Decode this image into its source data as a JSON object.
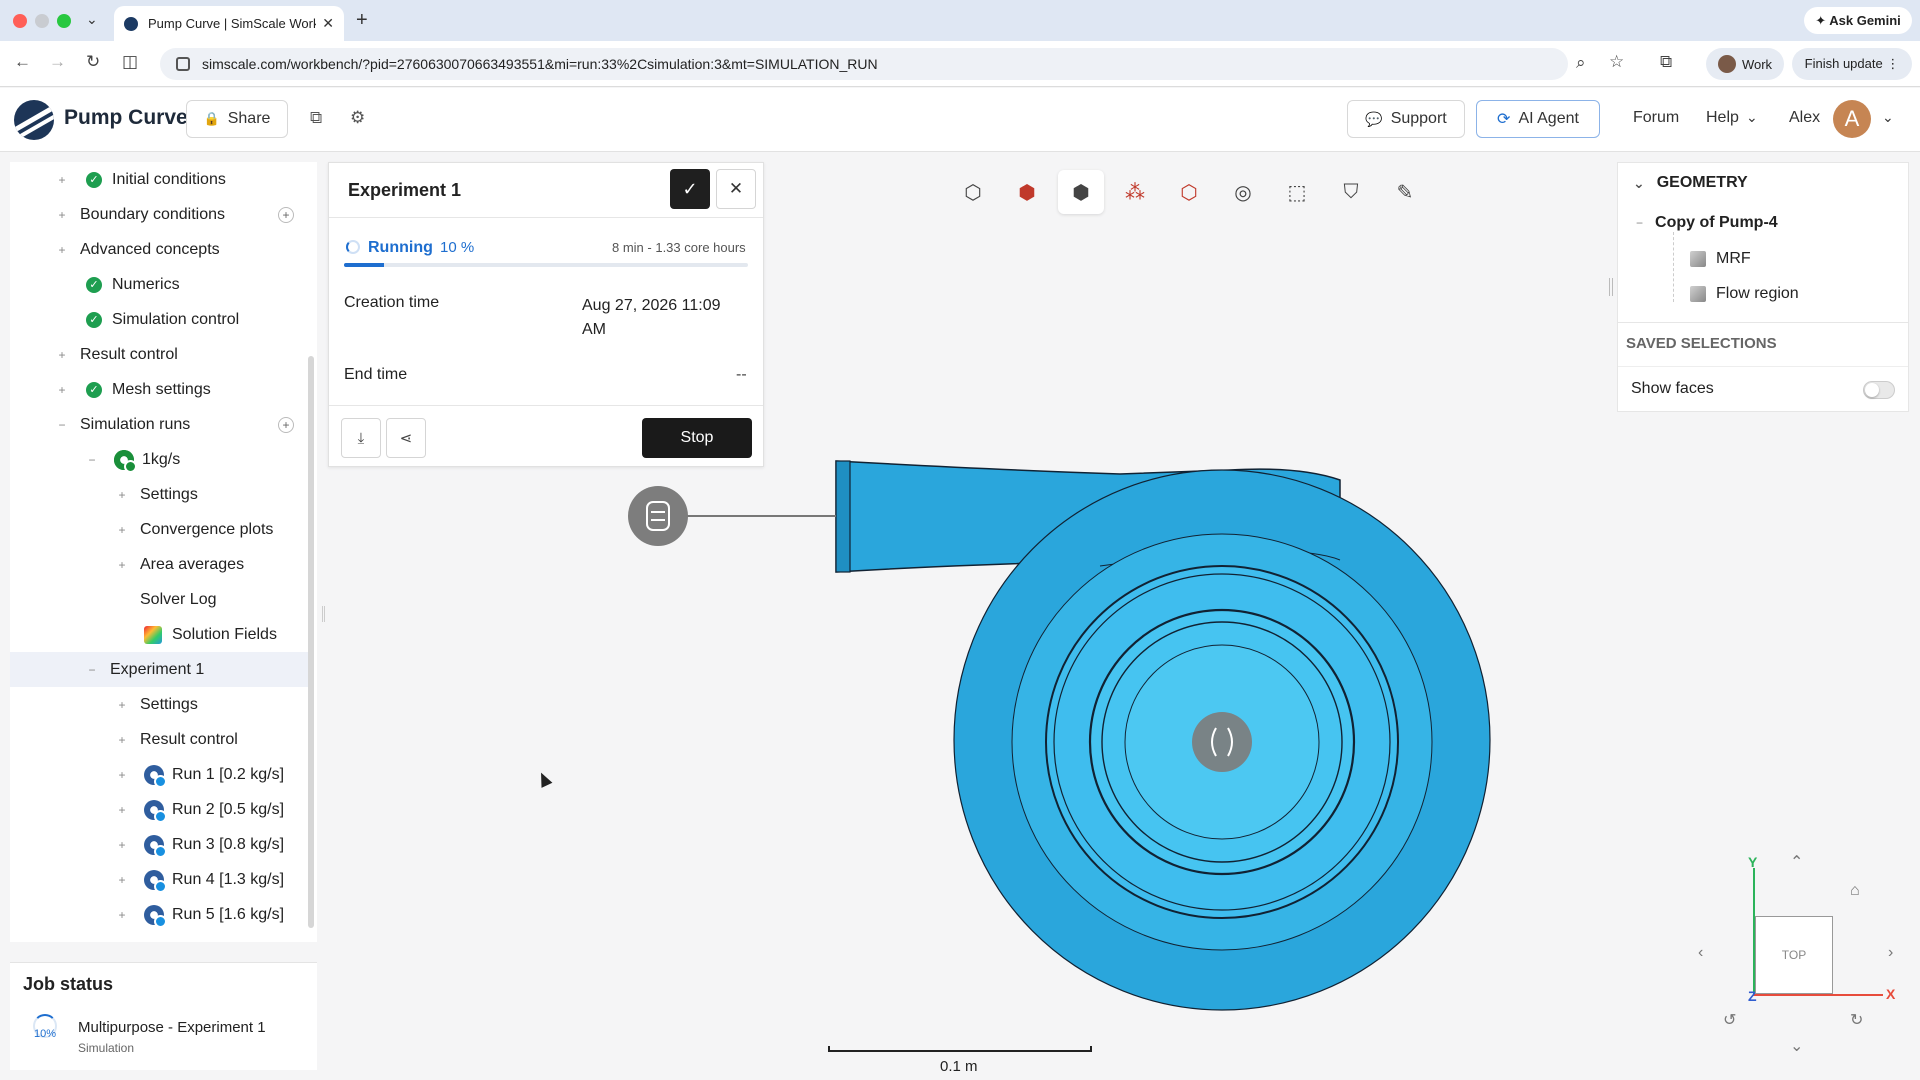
{
  "browser": {
    "tab_title": "Pump Curve | SimScale Workb",
    "tab_close": "✕",
    "new_tab": "+",
    "url": "simscale.com/workbench/?pid=2760630070663493551&mi=run:33%2Csimulation:3&mt=SIMULATION_RUN",
    "ask_gemini": "✦ Ask Gemini",
    "profile_label": "Work",
    "finish_update": "Finish update ⋮",
    "nav": {
      "back": "←",
      "forward": "→",
      "reload": "↻",
      "split": "◫",
      "zoom": "⌕",
      "star": "☆",
      "ext": "⧉",
      "tab_menu": "⌄"
    }
  },
  "header": {
    "title": "Pump Curve",
    "share": "Share",
    "support": "Support",
    "ai_agent": "AI Agent",
    "forum": "Forum",
    "help": "Help",
    "user": "Alex",
    "avatar_letter": "A",
    "icons": {
      "lock": "🔒",
      "copy": "⧉",
      "gear": "⚙",
      "support": "💬",
      "ai": "⟳",
      "chevron": "⌄"
    }
  },
  "tree": {
    "items": [
      {
        "label": "Initial conditions"
      },
      {
        "label": "Boundary conditions"
      },
      {
        "label": "Advanced concepts"
      },
      {
        "label": "Numerics"
      },
      {
        "label": "Simulation control"
      },
      {
        "label": "Result control"
      },
      {
        "label": "Mesh settings"
      },
      {
        "label": "Simulation runs"
      },
      {
        "label": "1kg/s"
      },
      {
        "label": "Settings"
      },
      {
        "label": "Convergence plots"
      },
      {
        "label": "Area averages"
      },
      {
        "label": "Solver Log"
      },
      {
        "label": "Solution Fields"
      },
      {
        "label": "Experiment 1"
      },
      {
        "label": "Settings"
      },
      {
        "label": "Result control"
      },
      {
        "label": "Run 1 [0.2 kg/s]"
      },
      {
        "label": "Run 2 [0.5 kg/s]"
      },
      {
        "label": "Run 3 [0.8 kg/s]"
      },
      {
        "label": "Run 4 [1.3 kg/s]"
      },
      {
        "label": "Run 5 [1.6 kg/s]"
      }
    ],
    "expand_plus": "+",
    "expand_minus": "−",
    "add": "+",
    "check": "✓"
  },
  "job_status": {
    "title": "Job status",
    "progress": "10%",
    "name": "Multipurpose - Experiment 1",
    "type": "Simulation"
  },
  "experiment": {
    "title": "Experiment 1",
    "status": "Running",
    "percent": "10 %",
    "progress_fraction": 0.1,
    "duration": "8 min - 1.33 core hours",
    "creation_label": "Creation time",
    "creation_value": "Aug 27, 2026 11:09 AM",
    "end_label": "End time",
    "end_value": "--",
    "stop": "Stop",
    "confirm_icon": "✓",
    "close_icon": "✕",
    "download_icon": "⤓",
    "share_icon": "⋖"
  },
  "viewer_tools": [
    "⬡",
    "⬢",
    "⬢",
    "⁂",
    "⬡",
    "◎",
    "⬚",
    "⛉",
    "✎"
  ],
  "geometry": {
    "title": "GEOMETRY",
    "parent": "Copy of Pump-4",
    "items": [
      "MRF",
      "Flow region"
    ],
    "saved_selections": "SAVED SELECTIONS",
    "show_faces": "Show faces"
  },
  "scale": {
    "label": "0.1 m"
  },
  "navcube": {
    "face": "TOP",
    "axis_y": "Y",
    "axis_x": "X",
    "axis_z": "Z",
    "up": "⌃",
    "down": "⌄",
    "left": "‹",
    "right": "›",
    "home": "⌂",
    "rot_left": "↺",
    "rot_right": "↻"
  },
  "colors": {
    "accent": "#1e6ecf",
    "pump": "#2aa6dc",
    "pump_light": "#4cc8f2",
    "success": "#1e9e50"
  }
}
